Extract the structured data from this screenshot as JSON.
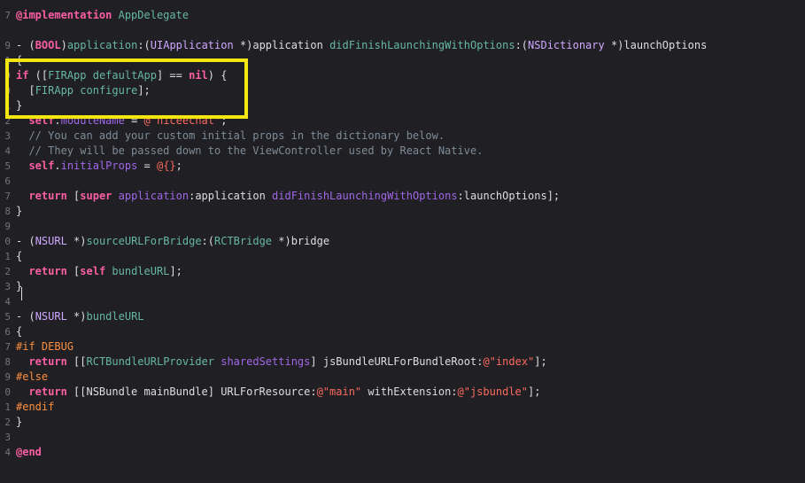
{
  "editor": {
    "highlight_color": "#f4e611",
    "lines": [
      {
        "num": "",
        "tokens": [
          {
            "t": "",
            "c": "plain"
          }
        ]
      },
      {
        "num": "7",
        "tokens": [
          {
            "t": "@implementation",
            "c": "kw"
          },
          {
            "t": " ",
            "c": "plain"
          },
          {
            "t": "AppDelegate",
            "c": "cls"
          }
        ]
      },
      {
        "num": "",
        "tokens": [
          {
            "t": "",
            "c": "plain"
          }
        ]
      },
      {
        "num": "9",
        "tokens": [
          {
            "t": "- (",
            "c": "plain"
          },
          {
            "t": "BOOL",
            "c": "kw"
          },
          {
            "t": ")",
            "c": "plain"
          },
          {
            "t": "application",
            "c": "meth"
          },
          {
            "t": ":(",
            "c": "plain"
          },
          {
            "t": "UIApplication",
            "c": "type"
          },
          {
            "t": " *)application ",
            "c": "plain"
          },
          {
            "t": "didFinishLaunchingWithOptions",
            "c": "meth"
          },
          {
            "t": ":(",
            "c": "plain"
          },
          {
            "t": "NSDictionary",
            "c": "type"
          },
          {
            "t": " *)launchOptions",
            "c": "plain"
          }
        ]
      },
      {
        "num": "1",
        "tokens": [
          {
            "t": "{",
            "c": "plain"
          }
        ]
      },
      {
        "num": "9",
        "tokens": [
          {
            "t": "if",
            "c": "kw"
          },
          {
            "t": " ([",
            "c": "plain"
          },
          {
            "t": "FIRApp",
            "c": "cls"
          },
          {
            "t": " ",
            "c": "plain"
          },
          {
            "t": "defaultApp",
            "c": "meth"
          },
          {
            "t": "] == ",
            "c": "plain"
          },
          {
            "t": "nil",
            "c": "kw"
          },
          {
            "t": ") {",
            "c": "plain"
          }
        ]
      },
      {
        "num": "0",
        "tokens": [
          {
            "t": "  [",
            "c": "plain"
          },
          {
            "t": "FIRApp",
            "c": "cls"
          },
          {
            "t": " ",
            "c": "plain"
          },
          {
            "t": "configure",
            "c": "meth"
          },
          {
            "t": "];",
            "c": "plain"
          }
        ]
      },
      {
        "num": "1",
        "tokens": [
          {
            "t": "}",
            "c": "plain"
          }
        ]
      },
      {
        "num": "2",
        "tokens": [
          {
            "t": "  ",
            "c": "plain"
          },
          {
            "t": "self",
            "c": "kw"
          },
          {
            "t": ".",
            "c": "plain"
          },
          {
            "t": "moduleName",
            "c": "ext"
          },
          {
            "t": " = ",
            "c": "plain"
          },
          {
            "t": "@\"niceechat\"",
            "c": "str"
          },
          {
            "t": ";",
            "c": "plain"
          }
        ]
      },
      {
        "num": "3",
        "tokens": [
          {
            "t": "  // You can add your custom initial props in the dictionary below.",
            "c": "cmt"
          }
        ]
      },
      {
        "num": "4",
        "tokens": [
          {
            "t": "  // They will be passed down to the ViewController used by React Native.",
            "c": "cmt"
          }
        ]
      },
      {
        "num": "5",
        "tokens": [
          {
            "t": "  ",
            "c": "plain"
          },
          {
            "t": "self",
            "c": "kw"
          },
          {
            "t": ".",
            "c": "plain"
          },
          {
            "t": "initialProps",
            "c": "ext"
          },
          {
            "t": " = ",
            "c": "plain"
          },
          {
            "t": "@{}",
            "c": "str"
          },
          {
            "t": ";",
            "c": "plain"
          }
        ]
      },
      {
        "num": "6",
        "tokens": [
          {
            "t": "",
            "c": "plain"
          }
        ]
      },
      {
        "num": "7",
        "tokens": [
          {
            "t": "  ",
            "c": "plain"
          },
          {
            "t": "return",
            "c": "kw"
          },
          {
            "t": " [",
            "c": "plain"
          },
          {
            "t": "super",
            "c": "kw"
          },
          {
            "t": " ",
            "c": "plain"
          },
          {
            "t": "application",
            "c": "ext"
          },
          {
            "t": ":application ",
            "c": "plain"
          },
          {
            "t": "didFinishLaunchingWithOptions",
            "c": "ext"
          },
          {
            "t": ":launchOptions];",
            "c": "plain"
          }
        ]
      },
      {
        "num": "8",
        "tokens": [
          {
            "t": "}",
            "c": "plain"
          }
        ]
      },
      {
        "num": "9",
        "tokens": [
          {
            "t": "",
            "c": "plain"
          }
        ]
      },
      {
        "num": "0",
        "tokens": [
          {
            "t": "- (",
            "c": "plain"
          },
          {
            "t": "NSURL",
            "c": "type"
          },
          {
            "t": " *)",
            "c": "plain"
          },
          {
            "t": "sourceURLForBridge",
            "c": "meth"
          },
          {
            "t": ":(",
            "c": "plain"
          },
          {
            "t": "RCTBridge",
            "c": "cls"
          },
          {
            "t": " *)bridge",
            "c": "plain"
          }
        ]
      },
      {
        "num": "1",
        "tokens": [
          {
            "t": "{",
            "c": "plain"
          }
        ]
      },
      {
        "num": "2",
        "tokens": [
          {
            "t": "  ",
            "c": "plain"
          },
          {
            "t": "return",
            "c": "kw"
          },
          {
            "t": " [",
            "c": "plain"
          },
          {
            "t": "self",
            "c": "kw"
          },
          {
            "t": " ",
            "c": "plain"
          },
          {
            "t": "bundleURL",
            "c": "meth"
          },
          {
            "t": "];",
            "c": "plain"
          }
        ]
      },
      {
        "num": "3",
        "tokens": [
          {
            "t": "}",
            "c": "plain"
          }
        ]
      },
      {
        "num": "4",
        "tokens": [
          {
            "t": "",
            "c": "plain"
          }
        ]
      },
      {
        "num": "5",
        "tokens": [
          {
            "t": "- (",
            "c": "plain"
          },
          {
            "t": "NSURL",
            "c": "type"
          },
          {
            "t": " *)",
            "c": "plain"
          },
          {
            "t": "bundleURL",
            "c": "meth"
          }
        ]
      },
      {
        "num": "6",
        "tokens": [
          {
            "t": "{",
            "c": "plain"
          }
        ]
      },
      {
        "num": "7",
        "tokens": [
          {
            "t": "#if DEBUG",
            "c": "pre"
          }
        ]
      },
      {
        "num": "8",
        "tokens": [
          {
            "t": "  ",
            "c": "plain"
          },
          {
            "t": "return",
            "c": "kw"
          },
          {
            "t": " [[",
            "c": "plain"
          },
          {
            "t": "RCTBundleURLProvider",
            "c": "cls"
          },
          {
            "t": " ",
            "c": "plain"
          },
          {
            "t": "sharedSettings",
            "c": "ext"
          },
          {
            "t": "] jsBundleURLForBundleRoot:",
            "c": "plain"
          },
          {
            "t": "@\"index\"",
            "c": "str"
          },
          {
            "t": "];",
            "c": "plain"
          }
        ]
      },
      {
        "num": "9",
        "tokens": [
          {
            "t": "#else",
            "c": "pre"
          }
        ]
      },
      {
        "num": "0",
        "tokens": [
          {
            "t": "  ",
            "c": "plain"
          },
          {
            "t": "return",
            "c": "kw"
          },
          {
            "t": " [[NSBundle mainBundle] URLForResource:",
            "c": "plain"
          },
          {
            "t": "@\"main\"",
            "c": "str"
          },
          {
            "t": " withExtension:",
            "c": "plain"
          },
          {
            "t": "@\"jsbundle\"",
            "c": "str"
          },
          {
            "t": "];",
            "c": "plain"
          }
        ]
      },
      {
        "num": "1",
        "tokens": [
          {
            "t": "#endif",
            "c": "pre"
          }
        ]
      },
      {
        "num": "2",
        "tokens": [
          {
            "t": "}",
            "c": "plain"
          }
        ]
      },
      {
        "num": "3",
        "tokens": [
          {
            "t": "",
            "c": "plain"
          }
        ]
      },
      {
        "num": "4",
        "tokens": [
          {
            "t": "@end",
            "c": "kw"
          }
        ]
      },
      {
        "num": "",
        "tokens": [
          {
            "t": "",
            "c": "plain"
          }
        ]
      }
    ]
  }
}
